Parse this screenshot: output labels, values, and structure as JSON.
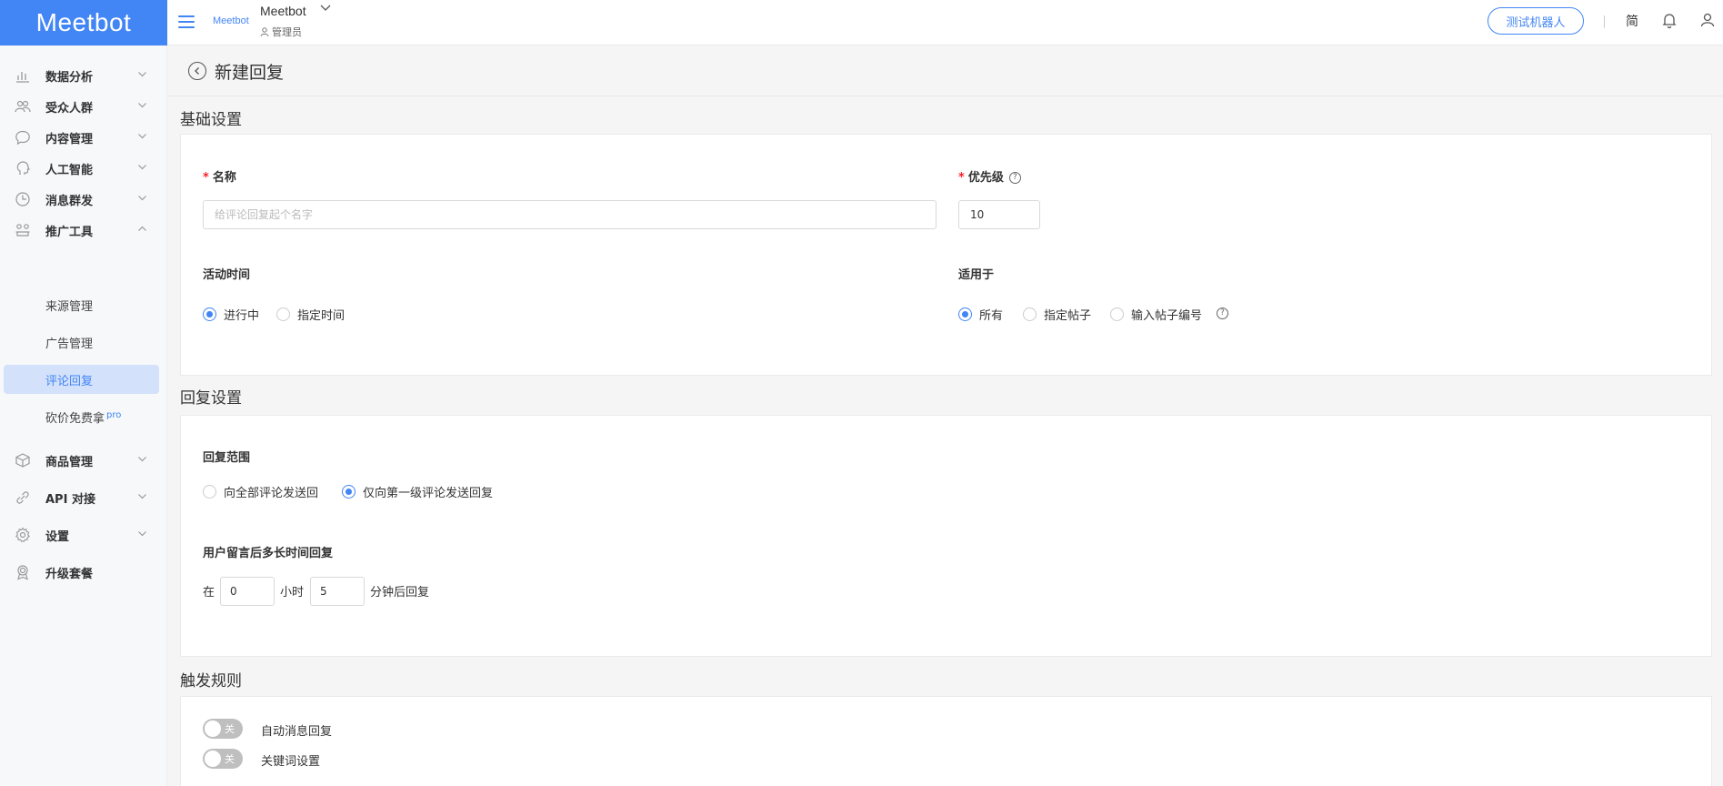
{
  "app": {
    "logo": "Meetbot",
    "mini_logo": "Meetbot",
    "accent": "#4285f4"
  },
  "topbar": {
    "bot_name": "Meetbot",
    "bot_role": "管理员",
    "test_button": "测试机器人",
    "lang": "简"
  },
  "sidebar": {
    "items": [
      {
        "label": "数据分析",
        "icon": "chart-icon"
      },
      {
        "label": "受众人群",
        "icon": "users-icon"
      },
      {
        "label": "内容管理",
        "icon": "chat-icon"
      },
      {
        "label": "人工智能",
        "icon": "brain-icon"
      },
      {
        "label": "消息群发",
        "icon": "clock-icon"
      },
      {
        "label": "推广工具",
        "icon": "megaphone-icon"
      },
      {
        "label": "商品管理",
        "icon": "box-icon"
      },
      {
        "label": "API 对接",
        "icon": "link-icon"
      },
      {
        "label": "设置",
        "icon": "gear-icon"
      },
      {
        "label": "升级套餐",
        "icon": "badge-icon"
      }
    ],
    "sub_items": [
      "来源管理",
      "广告管理",
      "评论回复",
      "砍价免费拿"
    ],
    "pro_badge": "pro"
  },
  "page": {
    "title": "新建回复"
  },
  "basic": {
    "section_title": "基础设置",
    "name_label": "名称",
    "name_placeholder": "给评论回复起个名字",
    "priority_label": "优先级",
    "priority_value": "10",
    "active_time_label": "活动时间",
    "active_options": [
      "进行中",
      "指定时间"
    ],
    "active_selected": "进行中",
    "applies_label": "适用于",
    "applies_options": [
      "所有",
      "指定帖子",
      "输入帖子编号"
    ],
    "applies_selected": "所有"
  },
  "reply": {
    "section_title": "回复设置",
    "scope_label": "回复范围",
    "scope_options": [
      "向全部评论发送回",
      "仅向第一级评论发送回复"
    ],
    "scope_selected": "仅向第一级评论发送回复",
    "delay_label": "用户留言后多长时间回复",
    "delay_prefix": "在",
    "hours_value": "0",
    "hours_unit": "小时",
    "minutes_value": "5",
    "minutes_suffix": "分钟后回复"
  },
  "trigger": {
    "section_title": "触发规则",
    "toggles": [
      {
        "label": "自动消息回复",
        "state": "关"
      },
      {
        "label": "关键词设置",
        "state": "关"
      }
    ]
  }
}
